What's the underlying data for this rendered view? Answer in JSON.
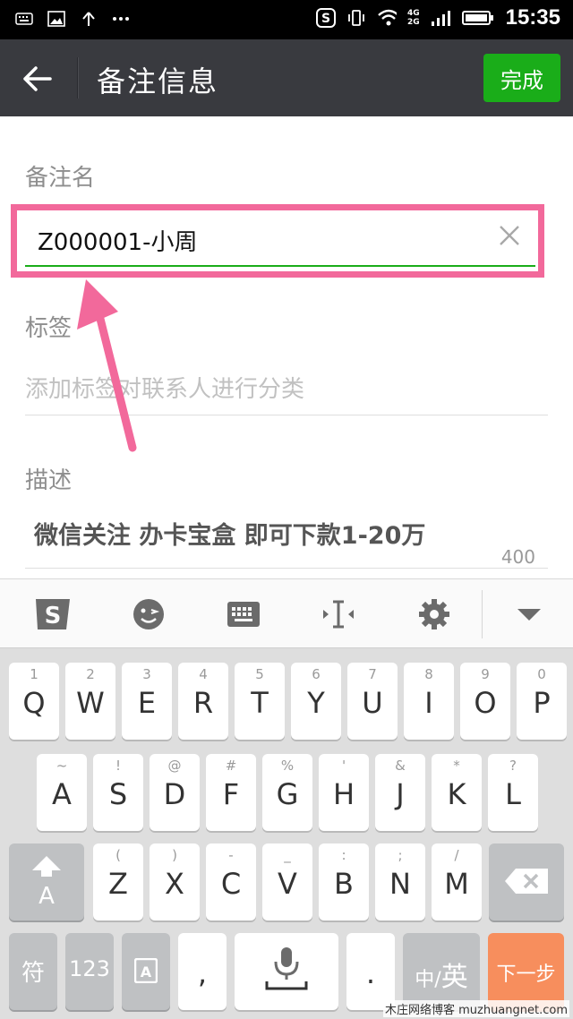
{
  "status_bar": {
    "time": "15:35",
    "network": [
      "4G",
      "2G"
    ],
    "left_icons": [
      "keyboard-icon",
      "image-icon",
      "upload-icon",
      "more-dots-icon"
    ],
    "right_icons": [
      "sogou-status-icon",
      "vibrate-icon",
      "wifi-icon",
      "signal-icon",
      "battery-icon"
    ]
  },
  "header": {
    "title": "备注信息",
    "done_label": "完成",
    "accent": "#1aad19"
  },
  "form": {
    "remark_label": "备注名",
    "remark_value": "Z000001-小周",
    "tags_label": "标签",
    "tags_placeholder": "添加标签对联系人进行分类",
    "desc_label": "描述",
    "desc_value": "微信关注 办卡宝盒 即可下款1-20万",
    "desc_counter": "400"
  },
  "keyboard": {
    "toolbar_icons": [
      "sogou-logo-icon",
      "emoji-icon",
      "keyboard-layout-icon",
      "cursor-icon",
      "settings-gear-icon",
      "collapse-down-icon"
    ],
    "row1": [
      {
        "main": "Q",
        "sub": "1"
      },
      {
        "main": "W",
        "sub": "2"
      },
      {
        "main": "E",
        "sub": "3"
      },
      {
        "main": "R",
        "sub": "4"
      },
      {
        "main": "T",
        "sub": "5"
      },
      {
        "main": "Y",
        "sub": "6"
      },
      {
        "main": "U",
        "sub": "7"
      },
      {
        "main": "I",
        "sub": "8"
      },
      {
        "main": "O",
        "sub": "9"
      },
      {
        "main": "P",
        "sub": "0"
      }
    ],
    "row2": [
      {
        "main": "A",
        "sub": "~"
      },
      {
        "main": "S",
        "sub": "!"
      },
      {
        "main": "D",
        "sub": "@"
      },
      {
        "main": "F",
        "sub": "#"
      },
      {
        "main": "G",
        "sub": "%"
      },
      {
        "main": "H",
        "sub": "'"
      },
      {
        "main": "J",
        "sub": "&"
      },
      {
        "main": "K",
        "sub": "*"
      },
      {
        "main": "L",
        "sub": "?"
      }
    ],
    "row3": [
      {
        "main": "Z",
        "sub": "("
      },
      {
        "main": "X",
        "sub": ")"
      },
      {
        "main": "C",
        "sub": "-"
      },
      {
        "main": "V",
        "sub": "_"
      },
      {
        "main": "B",
        "sub": ":"
      },
      {
        "main": "N",
        "sub": ";"
      },
      {
        "main": "M",
        "sub": "/"
      }
    ],
    "shift_label": "A",
    "symbol_label": "符",
    "num_label": "123",
    "comma_label": ",",
    "period_label": ".",
    "lang_zh": "中/",
    "lang_en": "英",
    "next_label": "下一步",
    "highlight_color": "#f2699b"
  },
  "watermark": "木庄网络博客 muzhuangnet.com"
}
